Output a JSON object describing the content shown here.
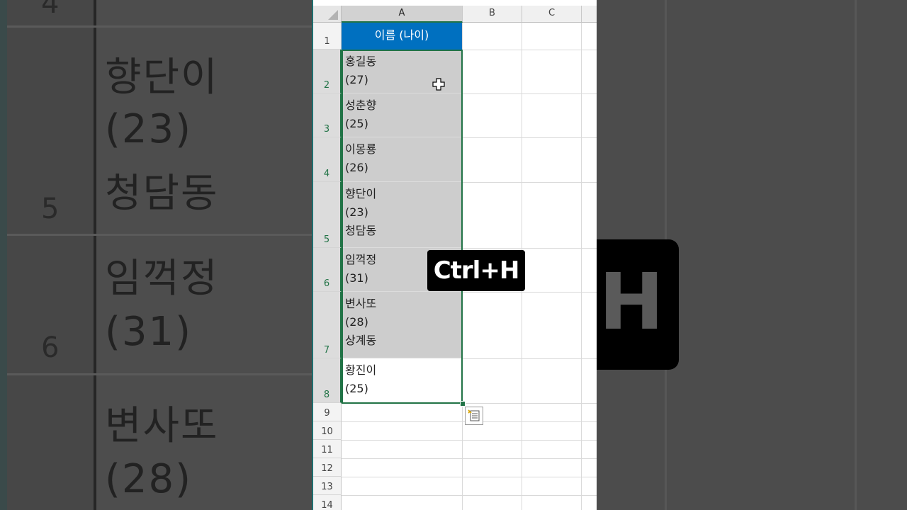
{
  "background": {
    "row_numbers": [
      "4",
      "5",
      "6"
    ],
    "texts": [
      "향단이",
      "(23)",
      "청담동",
      "임꺽정",
      "(31)",
      "변사또",
      "(28)"
    ],
    "key_letter": "H"
  },
  "sheet": {
    "columns": [
      "A",
      "B",
      "C"
    ],
    "row_numbers": [
      "1",
      "2",
      "3",
      "4",
      "5",
      "6",
      "7",
      "8",
      "9",
      "10",
      "11",
      "12",
      "13",
      "14"
    ],
    "header_cell": "이름 (나이)",
    "cells": [
      "홍길동\n(27)",
      "성춘향\n(25)",
      "이몽룡\n(26)",
      "향단이\n(23)\n청담동",
      "임꺽정\n(31)",
      "변사또\n(28)\n상계동",
      "황진이\n(25)"
    ]
  },
  "overlay": {
    "shortcut": "Ctrl+H"
  },
  "colors": {
    "header_fill": "#0070c0",
    "selection_border": "#217346",
    "selected_fill": "#cdcdcd"
  },
  "icons": {
    "cursor": "cell-select-cross-icon",
    "quick_analysis": "quick-analysis-icon"
  }
}
